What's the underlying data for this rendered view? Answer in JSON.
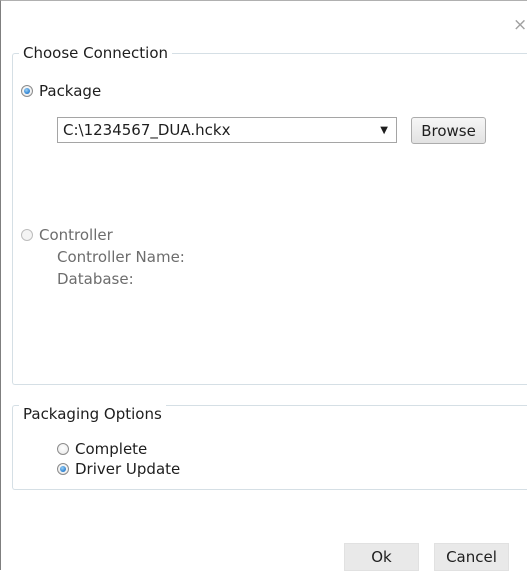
{
  "dialog": {
    "close_glyph": "×"
  },
  "connection": {
    "title": "Choose Connection",
    "package": {
      "label": "Package",
      "selected": true,
      "path_value": "C:\\1234567_DUA.hckx",
      "browse_label": "Browse"
    },
    "controller": {
      "label": "Controller",
      "selected": false,
      "name_label": "Controller Name:",
      "database_label": "Database:"
    }
  },
  "packaging": {
    "title": "Packaging Options",
    "options": [
      {
        "label": "Complete",
        "selected": false
      },
      {
        "label": "Driver Update",
        "selected": true
      }
    ]
  },
  "buttons": {
    "ok": "Ok",
    "cancel": "Cancel"
  },
  "icons": {
    "dropdown": "chevron-down-icon",
    "close": "close-icon"
  },
  "colors": {
    "accent_radio": "#2a7fd0",
    "group_border": "#d5dfe5"
  }
}
